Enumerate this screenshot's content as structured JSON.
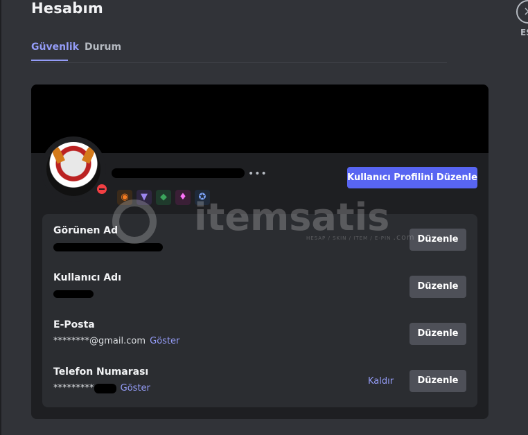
{
  "header": {
    "title": "Hesabım",
    "close_label": "ESC",
    "close_glyph": "×"
  },
  "tabs": [
    {
      "label": "Güvenlik",
      "active": true
    },
    {
      "label": "Durum",
      "active": false
    }
  ],
  "profile": {
    "more_glyph": "•••",
    "edit_profile_label": "Kullanıcı Profilini Düzenle",
    "badges": [
      "orange-badge-icon",
      "purple-badge-icon",
      "green-badge-icon",
      "pink-gem-badge-icon",
      "blue-laurel-badge-icon"
    ]
  },
  "fields": [
    {
      "label": "Görünen Ad",
      "value": "",
      "edit_label": "Düzenle"
    },
    {
      "label": "Kullanıcı Adı",
      "value": "",
      "edit_label": "Düzenle"
    },
    {
      "label": "E-Posta",
      "value": "********@gmail.com",
      "reveal_label": "Göster",
      "edit_label": "Düzenle"
    },
    {
      "label": "Telefon Numarası",
      "value": "*********",
      "reveal_label": "Göster",
      "remove_label": "Kaldır",
      "edit_label": "Düzenle"
    }
  ],
  "watermark": {
    "text": "itemsatis",
    "sub": "HESAP / SKIN / ITEM / E-PIN",
    "domain": ".com"
  },
  "colors": {
    "accent": "#5865f2",
    "link": "#949cf7",
    "danger": "#f23f43",
    "card": "#1e1f22",
    "panel": "#2b2d31"
  }
}
